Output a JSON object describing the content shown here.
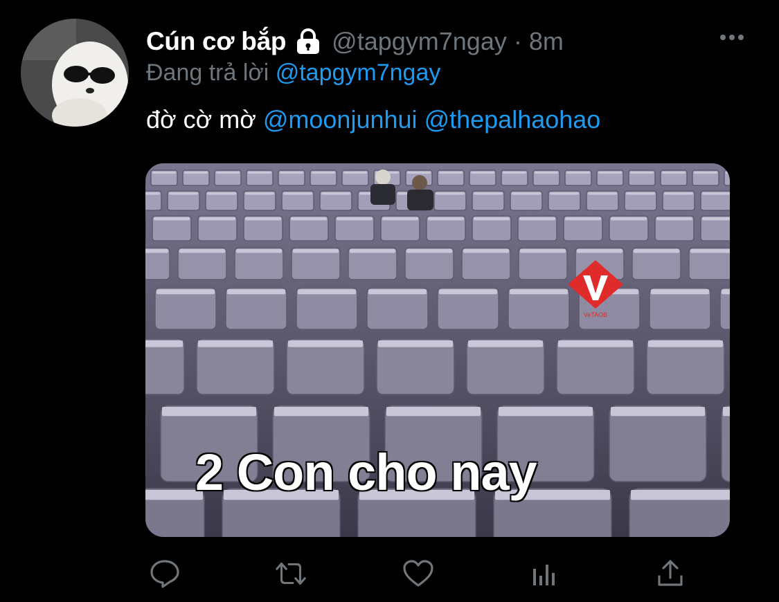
{
  "tweet": {
    "display_name": "Cún cơ bắp",
    "handle": "@tapgym7ngay",
    "separator": "·",
    "time": "8m",
    "reply_prefix": "Đang trả lời",
    "reply_to": "@tapgym7ngay",
    "text": "đờ cờ mờ",
    "mentions": [
      "@moonjunhui",
      "@thepalhaohao"
    ],
    "media_caption": "2 Con cho nay",
    "watermark_text": "VeTAOB"
  },
  "icons": {
    "lock": "lock-icon",
    "more": "more-icon",
    "reply": "reply-icon",
    "retweet": "retweet-icon",
    "like": "heart-icon",
    "analytics": "analytics-icon",
    "share": "share-icon"
  },
  "colors": {
    "background": "#000000",
    "text": "#ffffff",
    "muted": "#6e767d",
    "link": "#1d9bf0",
    "icon": "#71767b"
  }
}
